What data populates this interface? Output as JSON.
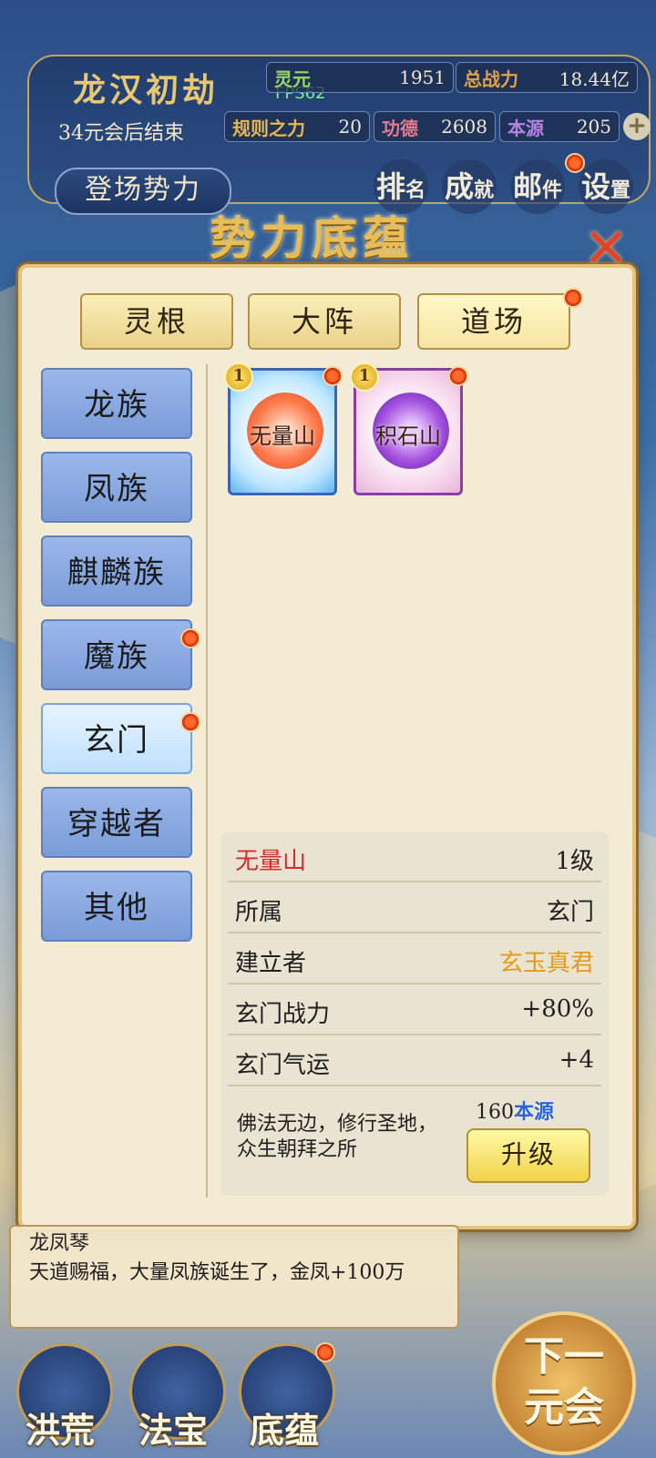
{
  "hud": {
    "era_title": "龙汉初劫",
    "era_subtitle": "34元会后结束",
    "fps": "FPS62",
    "stats": [
      {
        "label": "灵元",
        "value": "1951",
        "label_color": "#9bd56a"
      },
      {
        "label": "总战力",
        "value": "18.44亿",
        "label_color": "#e2a14a"
      },
      {
        "label": "规则之力",
        "value": "20",
        "label_color": "#e7b64e"
      },
      {
        "label": "功德",
        "value": "2608",
        "label_color": "#e57a8e"
      },
      {
        "label": "本源",
        "value": "205",
        "label_color": "#b684e3"
      }
    ],
    "plus": "+",
    "enter_button": "登场势力",
    "icons": [
      {
        "main": "排",
        "sub": "名"
      },
      {
        "main": "成",
        "sub": "就"
      },
      {
        "main": "邮",
        "sub": "件"
      },
      {
        "main": "设",
        "sub": "置"
      }
    ]
  },
  "modal": {
    "title": "势力底蕴",
    "close": "✕",
    "tabs": [
      {
        "label": "灵根",
        "active": false
      },
      {
        "label": "大阵",
        "active": false
      },
      {
        "label": "道场",
        "active": true
      }
    ],
    "categories": [
      {
        "label": "龙族",
        "active": false
      },
      {
        "label": "凤族",
        "active": false
      },
      {
        "label": "麒麟族",
        "active": false
      },
      {
        "label": "魔族",
        "active": false
      },
      {
        "label": "玄门",
        "active": true
      },
      {
        "label": "穿越者",
        "active": false
      },
      {
        "label": "其他",
        "active": false
      }
    ],
    "cards": [
      {
        "name": "无量山",
        "level": "1"
      },
      {
        "name": "积石山",
        "level": "1"
      }
    ],
    "detail": {
      "name": "无量山",
      "level": "1级",
      "rows": [
        {
          "key": "所属",
          "value": "玄门"
        },
        {
          "key": "建立者",
          "value": "玄玉真君"
        },
        {
          "key": "玄门战力",
          "value": "+80%"
        },
        {
          "key": "玄门气运",
          "value": "+4"
        }
      ],
      "description": "佛法无边，修行圣地，众生朝拜之所",
      "cost_amount": "160",
      "cost_currency": "本源",
      "upgrade_label": "升级"
    }
  },
  "log": {
    "title": "龙凤琴",
    "text": "天道赐福，大量凤族诞生了，金凤+100万"
  },
  "bottom_nav": [
    {
      "label": "洪荒"
    },
    {
      "label": "法宝"
    },
    {
      "label": "底蕴"
    }
  ],
  "next_button": {
    "line1": "下一",
    "line2": "元会"
  }
}
